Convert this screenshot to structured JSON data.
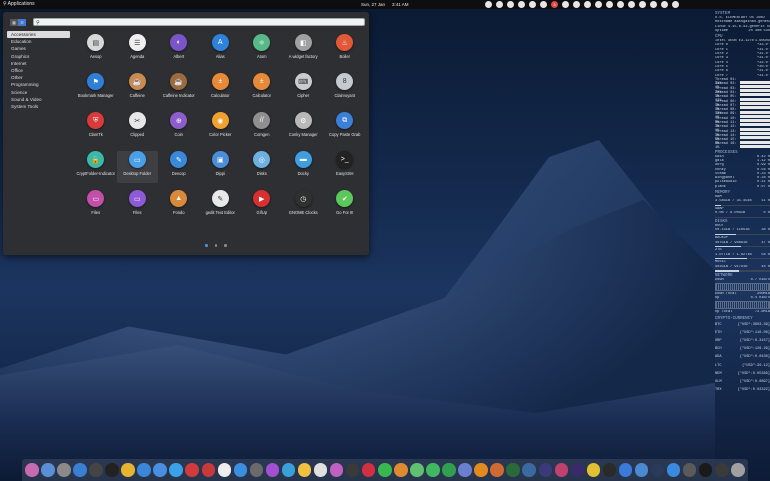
{
  "topbar": {
    "applications_label": "Applications",
    "date": "Sun, 27 Jan",
    "time": "3:41 AM",
    "indicator_badge": "3"
  },
  "launcher": {
    "categories": [
      "Accessories",
      "Education",
      "Games",
      "Graphics",
      "Internet",
      "Office",
      "Other",
      "Programming",
      "Science",
      "Sound & Video",
      "System Tools"
    ],
    "selected_category": "Accessories",
    "search_placeholder": "",
    "apps": [
      {
        "label": "Aesop",
        "icon": "book-icon",
        "color": "#d8d8d8",
        "glyph": "▤"
      },
      {
        "label": "Agenda",
        "icon": "checklist-icon",
        "color": "#efefef",
        "glyph": "☰"
      },
      {
        "label": "Albert",
        "icon": "albert-icon",
        "color": "#7a55c8",
        "glyph": "◐"
      },
      {
        "label": "Alias",
        "icon": "alias-icon",
        "color": "#2f82d9",
        "glyph": "A"
      },
      {
        "label": "Atom",
        "icon": "atom-icon",
        "color": "#59b887",
        "glyph": "⚛"
      },
      {
        "label": "A widget factory",
        "icon": "widget-factory-icon",
        "color": "#a0a0a0",
        "glyph": "◧"
      },
      {
        "label": "Boiler",
        "icon": "boiler-icon",
        "color": "#e2593a",
        "glyph": "♨"
      },
      {
        "label": "Bookmark Manager",
        "icon": "bookmark-icon",
        "color": "#2f7fd6",
        "glyph": "⚑"
      },
      {
        "label": "Caffeine",
        "icon": "coffee-icon",
        "color": "#c98b52",
        "glyph": "☕"
      },
      {
        "label": "Caffeine Indicator",
        "icon": "coffee-indicator-icon",
        "color": "#9b6a3f",
        "glyph": "☕"
      },
      {
        "label": "Calculator",
        "icon": "calculator-icon",
        "color": "#e68a3a",
        "glyph": "±"
      },
      {
        "label": "Calculator",
        "icon": "calculator-icon",
        "color": "#e68a3a",
        "glyph": "±"
      },
      {
        "label": "Cipher",
        "icon": "cipher-icon",
        "color": "#c8ccd2",
        "glyph": "⌨"
      },
      {
        "label": "Clairvoyant",
        "icon": "clairvoyant-icon",
        "color": "#c5c9d0",
        "glyph": "8"
      },
      {
        "label": "ClamTk",
        "icon": "shield-icon",
        "color": "#d93a3a",
        "glyph": "⛨"
      },
      {
        "label": "Clipped",
        "icon": "clipboard-icon",
        "color": "#e6e6e6",
        "glyph": "✂"
      },
      {
        "label": "Coin",
        "icon": "coin-icon",
        "color": "#8d5dc9",
        "glyph": "⊕"
      },
      {
        "label": "Color Picker",
        "icon": "color-picker-icon",
        "color": "#f0a030",
        "glyph": "◉"
      },
      {
        "label": "Comgen",
        "icon": "comgen-icon",
        "color": "#8f8f8f",
        "glyph": "//"
      },
      {
        "label": "Conky Manager",
        "icon": "conky-icon",
        "color": "#b8b8b8",
        "glyph": "⚙"
      },
      {
        "label": "Copy Paste Grab",
        "icon": "copy-paste-icon",
        "color": "#3b7fd8",
        "glyph": "⧉"
      },
      {
        "label": "CryptFolder-Indicator",
        "icon": "lock-folder-icon",
        "color": "#3cb8a8",
        "glyph": "🔒"
      },
      {
        "label": "Desktop Folder",
        "icon": "desktop-folder-icon",
        "color": "#4aa0e8",
        "glyph": "▭"
      },
      {
        "label": "Devcop",
        "icon": "devcop-icon",
        "color": "#3a88d8",
        "glyph": "✎"
      },
      {
        "label": "Dippi",
        "icon": "dippi-icon",
        "color": "#4b8ed8",
        "glyph": "▣"
      },
      {
        "label": "Disks",
        "icon": "disks-icon",
        "color": "#6eb0e0",
        "glyph": "◎"
      },
      {
        "label": "Docky",
        "icon": "docky-icon",
        "color": "#3e9ee0",
        "glyph": "▬"
      },
      {
        "label": "EasySSH",
        "icon": "terminal-icon",
        "color": "#222222",
        "glyph": ">_"
      },
      {
        "label": "Files",
        "icon": "files-icon",
        "color": "#c24fa8",
        "glyph": "▭"
      },
      {
        "label": "Files",
        "icon": "files-icon",
        "color": "#8f5ad8",
        "glyph": "▭"
      },
      {
        "label": "Fondo",
        "icon": "fondo-icon",
        "color": "#d88a3a",
        "glyph": "▲"
      },
      {
        "label": "gedit Text Editor",
        "icon": "text-editor-icon",
        "color": "#e8e8e8",
        "glyph": "✎"
      },
      {
        "label": "GifUp",
        "icon": "gifup-icon",
        "color": "#d83030",
        "glyph": "▶"
      },
      {
        "label": "GNOME Clocks",
        "icon": "clock-icon",
        "color": "#303030",
        "glyph": "◷"
      },
      {
        "label": "Go For It!",
        "icon": "go-for-it-icon",
        "color": "#5cc85c",
        "glyph": "✔"
      }
    ],
    "selected_app": "Desktop Folder",
    "pages": 3,
    "current_page": 1
  },
  "conky": {
    "system_title": "SYSTEM",
    "os_line": "O.S.   ELEMENTARY OS JUNO",
    "hostname_line": "Hostname  aashgathan-genesis",
    "kernel_line": "Linux 4.15.0-43-generic x86_64",
    "uptime_label": "Uptime",
    "uptime_value": "2h 30m 53s",
    "cpu_title": "CPU",
    "cpu_model": "Intel XEON E3-1270",
    "cpu_freq": "1.60GHz",
    "cores": [
      {
        "name": "Core 0",
        "temp": "+33.0°"
      },
      {
        "name": "Core 1",
        "temp": "+31.0°"
      },
      {
        "name": "Core 2",
        "temp": "+31.0°"
      },
      {
        "name": "Core 3",
        "temp": "+31.0°"
      },
      {
        "name": "Core 4",
        "temp": "+33.0°"
      },
      {
        "name": "Core 5",
        "temp": "+30.0°"
      },
      {
        "name": "Core 6",
        "temp": "+31.0°"
      },
      {
        "name": "Core 7",
        "temp": "+31.0°"
      }
    ],
    "threads": [
      "Thread 01: 31%",
      "Thread 02: 1%",
      "Thread 03: 20%",
      "Thread 04: 1%",
      "Thread 05: 13%",
      "Thread 06: 1%",
      "Thread 07: 1%",
      "Thread 08: 13%",
      "Thread 09: 1%",
      "Thread 10: 0%",
      "Thread 11: 1%",
      "Thread 12: 1%",
      "Thread 13: 1%",
      "Thread 14: 5%",
      "Thread 15: 0%",
      "Thread 16: 1%"
    ],
    "processes_title": "PROCESSES",
    "processes": [
      {
        "name": "kwin",
        "value": "8.42 %"
      },
      {
        "name": "gala",
        "value": "1.12 %"
      },
      {
        "name": "Xorg",
        "value": "0.99 %"
      },
      {
        "name": "conky",
        "value": "0.56 %"
      },
      {
        "name": "steam",
        "value": "0.33 %"
      },
      {
        "name": "wingpanel",
        "value": "0.28 %"
      },
      {
        "name": "pulseaudio",
        "value": "0.11 %"
      },
      {
        "name": "plank",
        "value": "0.07 %"
      }
    ],
    "memory_title": "MEMORY",
    "ram_label": "RAM",
    "ram_value": "3.58GiB / 31.4GiB",
    "ram_pct": "11 %",
    "ram_fill": 0.11,
    "swap_label": "SWAP",
    "swap_value": "0.0B / 8.00GiB",
    "swap_pct": "0 %",
    "swap_fill": 0.0,
    "disks_title": "DISKS",
    "disks": [
      {
        "name": "ROOT",
        "value": "50.1GiB / 110GiB",
        "pct": "38 %",
        "fill": 0.38
      },
      {
        "name": "BACKUP",
        "value": "407GiB / 908GiB",
        "pct": "47 %",
        "fill": 0.47
      },
      {
        "name": "2TB",
        "value": "1.07TiB / 1.82TiB",
        "pct": "58 %",
        "fill": 0.58
      },
      {
        "name": "MUSIC",
        "value": "402GiB / 917GiB",
        "pct": "44 %",
        "fill": 0.44
      }
    ],
    "network_title": "NETWORK",
    "down_label": "Down",
    "down_value": "0.7 KiB/s",
    "down_total_label": "Down Total",
    "down_total_value": "200MiB",
    "up_label": "Up",
    "up_value": "0.4 KiB/s",
    "up_total_label": "Up Total",
    "up_total_value": "73.6MiB",
    "crypto_title": "CRYPTO-CURRENCY",
    "crypto": [
      {
        "sym": "BTC",
        "value": "{\"USD\":3603.39}"
      },
      {
        "sym": "ETH",
        "value": "{\"USD\":116.06}"
      },
      {
        "sym": "XRP",
        "value": "{\"USD\":0.3157}"
      },
      {
        "sym": "BCH",
        "value": "{\"USD\":126.29}"
      },
      {
        "sym": "ADA",
        "value": "{\"USD\":0.0430}"
      },
      {
        "sym": "LTC",
        "value": "{\"USD\":30.12}"
      },
      {
        "sym": "NEM",
        "value": "{\"USD\":0.05389}"
      },
      {
        "sym": "XLM",
        "value": "{\"USD\":0.0897}"
      },
      {
        "sym": "TRX",
        "value": "{\"USD\":0.02322}"
      }
    ]
  },
  "dock": {
    "items": [
      {
        "icon": "launchpad-icon",
        "color": "#c86ab0"
      },
      {
        "icon": "files-icon",
        "color": "#5a8fd8"
      },
      {
        "icon": "rocket-icon",
        "color": "#8a8a8a"
      },
      {
        "icon": "apps-grid-icon",
        "color": "#3a7fd6"
      },
      {
        "icon": "system-settings-icon",
        "color": "#444"
      },
      {
        "icon": "terminal-icon",
        "color": "#222"
      },
      {
        "icon": "chrome-icon",
        "color": "#e8b430"
      },
      {
        "icon": "browser-icon",
        "color": "#3a86d8"
      },
      {
        "icon": "mail-icon",
        "color": "#4a8ee0"
      },
      {
        "icon": "twitter-icon",
        "color": "#3aa0e8"
      },
      {
        "icon": "download-icon",
        "color": "#d03a3a"
      },
      {
        "icon": "screenshot-icon",
        "color": "#c83a3a"
      },
      {
        "icon": "calendar-icon",
        "color": "#eee"
      },
      {
        "icon": "messenger-icon",
        "color": "#3a8fe0"
      },
      {
        "icon": "vpn-icon",
        "color": "#6a6a6a"
      },
      {
        "icon": "podcasts-icon",
        "color": "#a050d0"
      },
      {
        "icon": "telegram-icon",
        "color": "#3aa0d8"
      },
      {
        "icon": "notes-icon",
        "color": "#f0c040"
      },
      {
        "icon": "photos-icon",
        "color": "#e0e0e0"
      },
      {
        "icon": "music-icon",
        "color": "#c060c0"
      },
      {
        "icon": "spotify-icon",
        "color": "#3a3a3a"
      },
      {
        "icon": "pinterest-icon",
        "color": "#d03040"
      },
      {
        "icon": "whatsapp-icon",
        "color": "#3ab850"
      },
      {
        "icon": "rss-icon",
        "color": "#e08a30"
      },
      {
        "icon": "tasks-icon",
        "color": "#60c070"
      },
      {
        "icon": "phone-icon",
        "color": "#40b860"
      },
      {
        "icon": "hangouts-icon",
        "color": "#30a050"
      },
      {
        "icon": "ethereum-icon",
        "color": "#6a7fd0"
      },
      {
        "icon": "vlc-icon",
        "color": "#e08a20"
      },
      {
        "icon": "wallet-icon",
        "color": "#d06a30"
      },
      {
        "icon": "audition-icon",
        "color": "#2a6a3a"
      },
      {
        "icon": "globe-icon",
        "color": "#3a6aa0"
      },
      {
        "icon": "lightroom-icon",
        "color": "#3a3a7a"
      },
      {
        "icon": "indesign-icon",
        "color": "#c04070"
      },
      {
        "icon": "premiere-icon",
        "color": "#3a2a6a"
      },
      {
        "icon": "radiation-icon",
        "color": "#e0c030"
      },
      {
        "icon": "gamepad-icon",
        "color": "#2a2a2a"
      },
      {
        "icon": "appcenter-icon",
        "color": "#3a7ad8"
      },
      {
        "icon": "sync-icon",
        "color": "#4a8ad0"
      },
      {
        "icon": "steam-icon",
        "color": "#2a3a5a"
      },
      {
        "icon": "store-icon",
        "color": "#3a8ae0"
      },
      {
        "icon": "settings-icon",
        "color": "#5a5a5a"
      },
      {
        "icon": "terminal-icon",
        "color": "#1a1a1a"
      },
      {
        "icon": "monitor-icon",
        "color": "#3a3a3a"
      },
      {
        "icon": "trash-icon",
        "color": "#a0a0a0"
      }
    ]
  }
}
